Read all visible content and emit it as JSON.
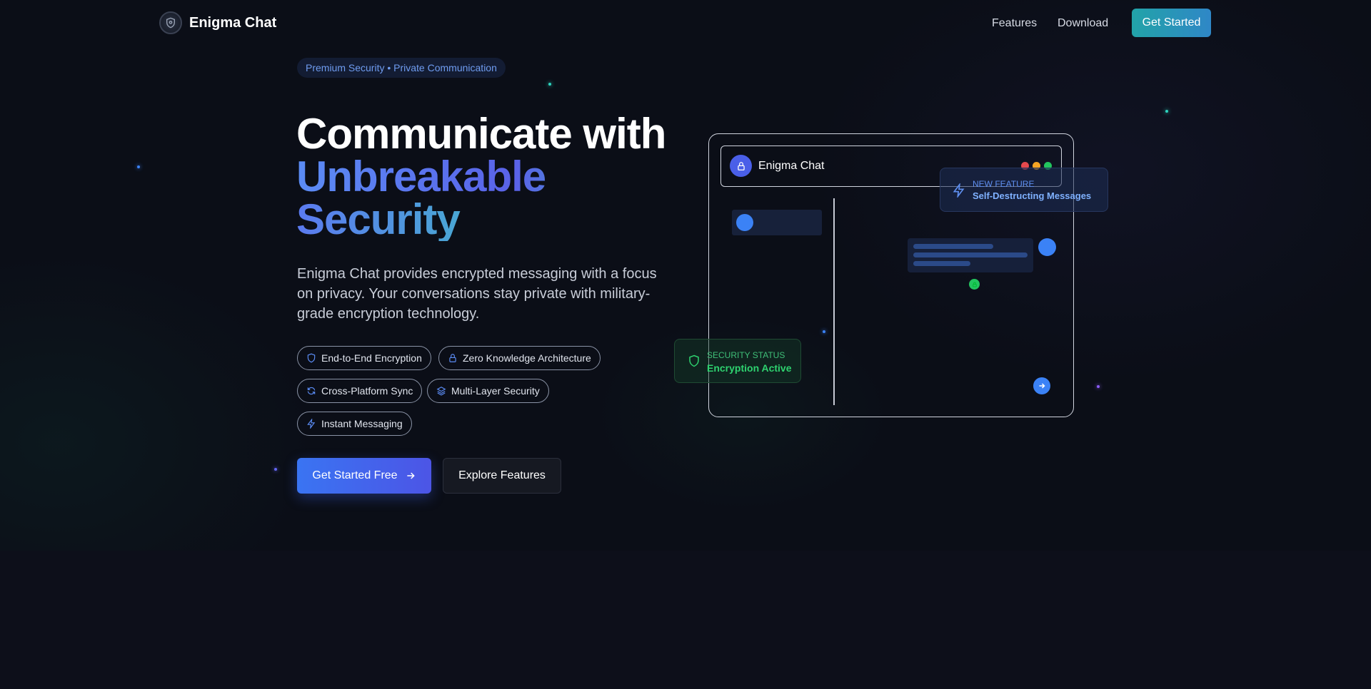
{
  "nav": {
    "brand": "Enigma Chat",
    "links": [
      "Features",
      "Download"
    ],
    "cta": "Get Started"
  },
  "hero": {
    "badge": "Premium Security • Private Communication",
    "headline_line1": "Communicate with",
    "headline_line2": "Unbreakable",
    "headline_line3": "Security",
    "description": "Enigma Chat provides encrypted messaging with a focus on privacy. Your conversations stay private with military-grade encryption technology.",
    "features": [
      {
        "label": "End-to-End Encryption",
        "icon": "shield-icon"
      },
      {
        "label": "Zero Knowledge Architecture",
        "icon": "lock-icon"
      },
      {
        "label": "Cross-Platform Sync",
        "icon": "sync-icon"
      },
      {
        "label": "Multi-Layer Security",
        "icon": "layers-icon"
      },
      {
        "label": "Instant Messaging",
        "icon": "bolt-icon"
      }
    ],
    "primary_cta": "Get Started Free",
    "secondary_cta": "Explore Features"
  },
  "mockup": {
    "title": "Enigma Chat",
    "window_dot_colors": [
      "#e5484d",
      "#f5a524",
      "#22c55e"
    ]
  },
  "feature_card": {
    "label": "NEW FEATURE",
    "title": "Self-Destructing Messages"
  },
  "status_card": {
    "label": "SECURITY STATUS",
    "title": "Encryption Active"
  },
  "colors": {
    "background": "#0b0e17",
    "accent_blue": "#3b82f6",
    "accent_teal": "#22a3a8",
    "success_green": "#22c55e"
  }
}
